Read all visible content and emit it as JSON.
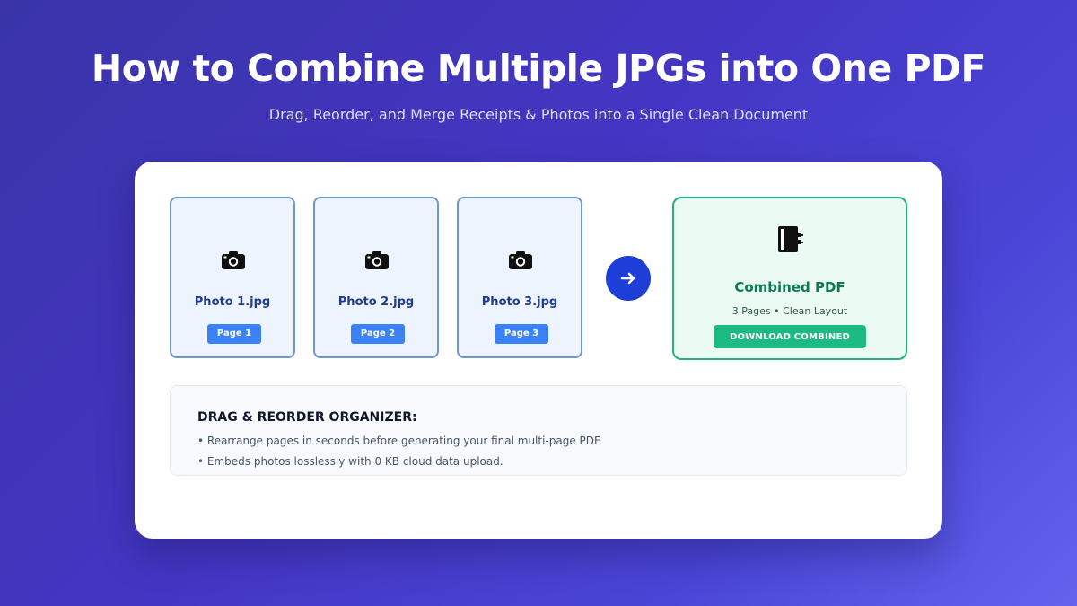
{
  "header": {
    "title": "How to Combine Multiple JPGs into One PDF",
    "subtitle": "Drag, Reorder, and Merge Receipts & Photos into a Single Clean Document"
  },
  "photos": [
    {
      "name": "Photo 1.jpg",
      "page_label": "Page 1",
      "icon": "camera-icon"
    },
    {
      "name": "Photo 2.jpg",
      "page_label": "Page 2",
      "icon": "camera-icon"
    },
    {
      "name": "Photo 3.jpg",
      "page_label": "Page 3",
      "icon": "camera-icon"
    }
  ],
  "arrow_icon": "arrow-right-icon",
  "result": {
    "icon": "document-icon",
    "title": "Combined PDF",
    "meta": "3 Pages • Clean Layout",
    "download_label": "DOWNLOAD COMBINED"
  },
  "organizer": {
    "heading": "DRAG & REORDER ORGANIZER:",
    "bullets": [
      "• Rearrange pages in seconds before generating your final multi-page PDF.",
      "• Embeds photos losslessly with 0 KB cloud data upload."
    ]
  },
  "colors": {
    "accent_blue": "#3b82f6",
    "arrow_blue": "#1e3ed8",
    "success_green": "#1dbb84",
    "tile_border": "#6c98cf"
  }
}
